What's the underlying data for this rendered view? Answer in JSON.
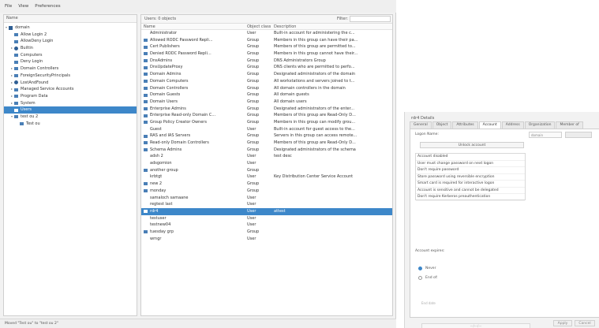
{
  "menu": [
    "File",
    "View",
    "Preferences"
  ],
  "tree": {
    "header": "Name",
    "items": [
      {
        "label": "domain",
        "depth": 0,
        "arrow": "▾",
        "icon": "domain"
      },
      {
        "label": "Allow Login 2",
        "depth": 1,
        "arrow": "",
        "icon": "folder"
      },
      {
        "label": "AllowDeny Login",
        "depth": 1,
        "arrow": "",
        "icon": "folder"
      },
      {
        "label": "Builtin",
        "depth": 1,
        "arrow": "▸",
        "icon": "ou"
      },
      {
        "label": "Computers",
        "depth": 1,
        "arrow": "",
        "icon": "folder"
      },
      {
        "label": "Deny Login",
        "depth": 1,
        "arrow": "",
        "icon": "folder"
      },
      {
        "label": "Domain Controllers",
        "depth": 1,
        "arrow": "▸",
        "icon": "folder"
      },
      {
        "label": "ForeignSecurityPrincipals",
        "depth": 1,
        "arrow": "▸",
        "icon": "folder"
      },
      {
        "label": "LostAndFound",
        "depth": 1,
        "arrow": "▸",
        "icon": "ou"
      },
      {
        "label": "Managed Service Accounts",
        "depth": 1,
        "arrow": "▸",
        "icon": "folder"
      },
      {
        "label": "Program Data",
        "depth": 1,
        "arrow": "▸",
        "icon": "folder"
      },
      {
        "label": "System",
        "depth": 1,
        "arrow": "▸",
        "icon": "folder"
      },
      {
        "label": "Users",
        "depth": 1,
        "arrow": "",
        "icon": "folder",
        "selected": true
      },
      {
        "label": "test ou 2",
        "depth": 1,
        "arrow": "▾",
        "icon": "folder"
      },
      {
        "label": "Test ou",
        "depth": 2,
        "arrow": "",
        "icon": "folder"
      }
    ]
  },
  "list": {
    "location": "Users: 0 objects",
    "filter_label": "Filter:",
    "headers": {
      "name": "Name",
      "class": "Object class",
      "desc": "Description"
    },
    "rows": [
      {
        "name": "Administrator",
        "cls": "User",
        "desc": "Built-in account for administering the c...",
        "icon": "user"
      },
      {
        "name": "Allowed RODC Password Repli...",
        "cls": "Group",
        "desc": "Members in this group can have their pa...",
        "icon": "group"
      },
      {
        "name": "Cert Publishers",
        "cls": "Group",
        "desc": "Members of this group are permitted to...",
        "icon": "group"
      },
      {
        "name": "Denied RODC Password Repli...",
        "cls": "Group",
        "desc": "Members in this group cannot have their...",
        "icon": "group"
      },
      {
        "name": "DnsAdmins",
        "cls": "Group",
        "desc": "DNS Administrators Group",
        "icon": "group"
      },
      {
        "name": "DnsUpdateProxy",
        "cls": "Group",
        "desc": "DNS clients who are permitted to perfo...",
        "icon": "group"
      },
      {
        "name": "Domain Admins",
        "cls": "Group",
        "desc": "Designated administrators of the domain",
        "icon": "group"
      },
      {
        "name": "Domain Computers",
        "cls": "Group",
        "desc": "All workstations and servers joined to t...",
        "icon": "group"
      },
      {
        "name": "Domain Controllers",
        "cls": "Group",
        "desc": "All domain controllers in the domain",
        "icon": "group"
      },
      {
        "name": "Domain Guests",
        "cls": "Group",
        "desc": "All domain guests",
        "icon": "group"
      },
      {
        "name": "Domain Users",
        "cls": "Group",
        "desc": "All domain users",
        "icon": "group"
      },
      {
        "name": "Enterprise Admins",
        "cls": "Group",
        "desc": "Designated administrators of the enter...",
        "icon": "group"
      },
      {
        "name": "Enterprise Read-only Domain C...",
        "cls": "Group",
        "desc": "Members of this group are Read-Only D...",
        "icon": "group"
      },
      {
        "name": "Group Policy Creator Owners",
        "cls": "Group",
        "desc": "Members in this group can modify grou...",
        "icon": "group"
      },
      {
        "name": "Guest",
        "cls": "User",
        "desc": "Built-in account for guest access to the...",
        "icon": "user"
      },
      {
        "name": "RAS and IAS Servers",
        "cls": "Group",
        "desc": "Servers in this group can access remote...",
        "icon": "group"
      },
      {
        "name": "Read-only Domain Controllers",
        "cls": "Group",
        "desc": "Members of this group are Read-Only D...",
        "icon": "group"
      },
      {
        "name": "Schema Admins",
        "cls": "Group",
        "desc": "Designated administrators of the schema",
        "icon": "group"
      },
      {
        "name": "adsh 2",
        "cls": "User",
        "desc": "test desc",
        "icon": "user"
      },
      {
        "name": "adsgomion",
        "cls": "User",
        "desc": "",
        "icon": "user"
      },
      {
        "name": "another group",
        "cls": "Group",
        "desc": "",
        "icon": "group"
      },
      {
        "name": "krbtgt",
        "cls": "User",
        "desc": "Key Distribution Center Service Account",
        "icon": "user"
      },
      {
        "name": "new 2",
        "cls": "Group",
        "desc": "",
        "icon": "group"
      },
      {
        "name": "monday",
        "cls": "Group",
        "desc": "",
        "icon": "group"
      },
      {
        "name": "samaloch samaane",
        "cls": "User",
        "desc": "",
        "icon": "user"
      },
      {
        "name": "regtest last",
        "cls": "User",
        "desc": "",
        "icon": "user"
      },
      {
        "name": "rdr4",
        "cls": "User",
        "desc": "attest",
        "icon": "user",
        "selected": true
      },
      {
        "name": "testuser",
        "cls": "User",
        "desc": "",
        "icon": "user"
      },
      {
        "name": "testnew04",
        "cls": "User",
        "desc": "",
        "icon": "user"
      },
      {
        "name": "tuesday grp",
        "cls": "Group",
        "desc": "",
        "icon": "group"
      },
      {
        "name": "wrngr",
        "cls": "User",
        "desc": "",
        "icon": "user"
      }
    ]
  },
  "status": "Moved \"Test ou\" to \"test ou 2\"",
  "dialog": {
    "title": "rdr4 Details",
    "tabs": [
      "General",
      "Object",
      "Attributes",
      "Account",
      "Address",
      "Organization",
      "Member of"
    ],
    "active_tab": "Account",
    "logon_label": "Logon Name:",
    "domain_value": "domain",
    "unlock_label": "Unlock account",
    "options": [
      "Account disabled",
      "User must change password on next logon",
      "Don't require password",
      "Store password using reversible encryption",
      "Smart card is required for interactive logon",
      "Account is sensitive and cannot be delegated",
      "Don't require Kerberos preauthentication"
    ],
    "expires_label": "Account expires:",
    "never_label": "Never",
    "end_of_label": "End of:",
    "end_date_placeholder": "End date",
    "end_date_value": "—/—/—",
    "buttons": [
      "Apply",
      "Cancel"
    ]
  },
  "colors": {
    "selection": "#3d87c9",
    "group_icon": "#4a7fb6"
  }
}
